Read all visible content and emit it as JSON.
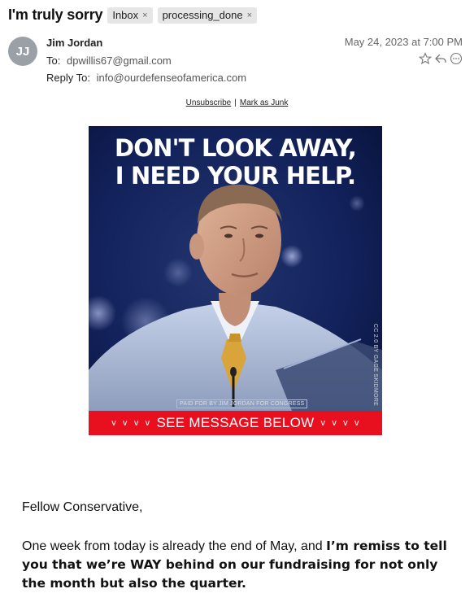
{
  "email": {
    "subject": "I'm truly sorry",
    "tags": [
      {
        "label": "Inbox"
      },
      {
        "label": "processing_done"
      }
    ],
    "avatar_initials": "JJ",
    "from_name": "Jim Jordan",
    "to_label": "To:",
    "to_value": "dpwillis67@gmail.com",
    "reply_to_label": "Reply To:",
    "reply_to_value": "info@ourdefenseofamerica.com",
    "date": "May 24, 2023 at 7:00 PM",
    "actions": [
      "star-icon",
      "reply-icon",
      "more-icon"
    ]
  },
  "links": {
    "unsubscribe": "Unsubscribe",
    "separator": "|",
    "mark_as_junk": "Mark as Junk"
  },
  "banner": {
    "headline_line1": "DON'T LOOK AWAY,",
    "headline_line2": "I NEED YOUR HELP.",
    "paid_for": "PAID FOR BY JIM JORDAN FOR CONGRESS",
    "photo_credit": "CC 2.0 BY GAGE SKIDMORE",
    "cta_label": "SEE MESSAGE BELOW",
    "cta_chevron": "v",
    "cta_color": "#e8101f"
  },
  "body": {
    "greeting": "Fellow Conservative,",
    "para_plain": "One week from today is already the end of May, and ",
    "para_bold": "I’m remiss to tell you that we’re WAY behind on our fundraising for not only the month but also the quarter."
  }
}
